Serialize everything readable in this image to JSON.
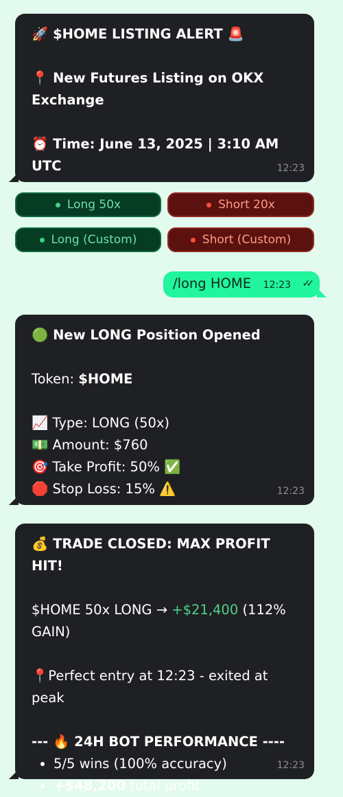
{
  "alert": {
    "title_emoji": "🚀",
    "title": "$HOME LISTING ALERT",
    "title_tail_emoji": "🚨",
    "pin_emoji": "📍",
    "listing": "New Futures Listing on OKX Exchange",
    "clock_emoji": "⏰",
    "time_text": "Time: June 13, 2025 | 3:10 AM UTC",
    "timestamp": "12:23"
  },
  "buttons": {
    "long_50x": "Long 50x",
    "short_20x": "Short 20x",
    "long_custom": "Long (Custom)",
    "short_custom": "Short (Custom)"
  },
  "outgoing": {
    "text": "/long HOME",
    "timestamp": "12:23",
    "ticks": "✓✓"
  },
  "position": {
    "header_emoji": "🟢",
    "header": "New LONG Position Opened",
    "token_label": "Token: ",
    "token_value": "$HOME",
    "type_emoji": "📈",
    "type_text": "Type: LONG (50x)",
    "amount_emoji": "💵",
    "amount_text": "Amount: $760",
    "tp_emoji": "🎯",
    "tp_text": "Take Profit: 50%",
    "tp_tail_emoji": "✅",
    "sl_emoji": "🛑",
    "sl_text": "Stop Loss: 15%",
    "sl_tail_emoji": "⚠️",
    "timestamp": "12:23"
  },
  "closed": {
    "header_emoji": "💰",
    "header": "TRADE CLOSED: MAX PROFIT HIT!",
    "result_prefix": "$HOME 50x LONG → ",
    "result_profit": "+$21,400",
    "result_suffix": " (112% GAIN)",
    "entry_emoji": "📍",
    "entry_text": "Perfect entry at 12:23 - exited at peak",
    "perf_prefix": "--- ",
    "perf_emoji": "🔥",
    "perf_title": " 24H BOT PERFORMANCE ----",
    "perf_wins": "5/5 wins (100% accuracy)",
    "perf_profit_bold": "+$48,200",
    "perf_profit_rest": " total profit",
    "timestamp": "12:23"
  }
}
